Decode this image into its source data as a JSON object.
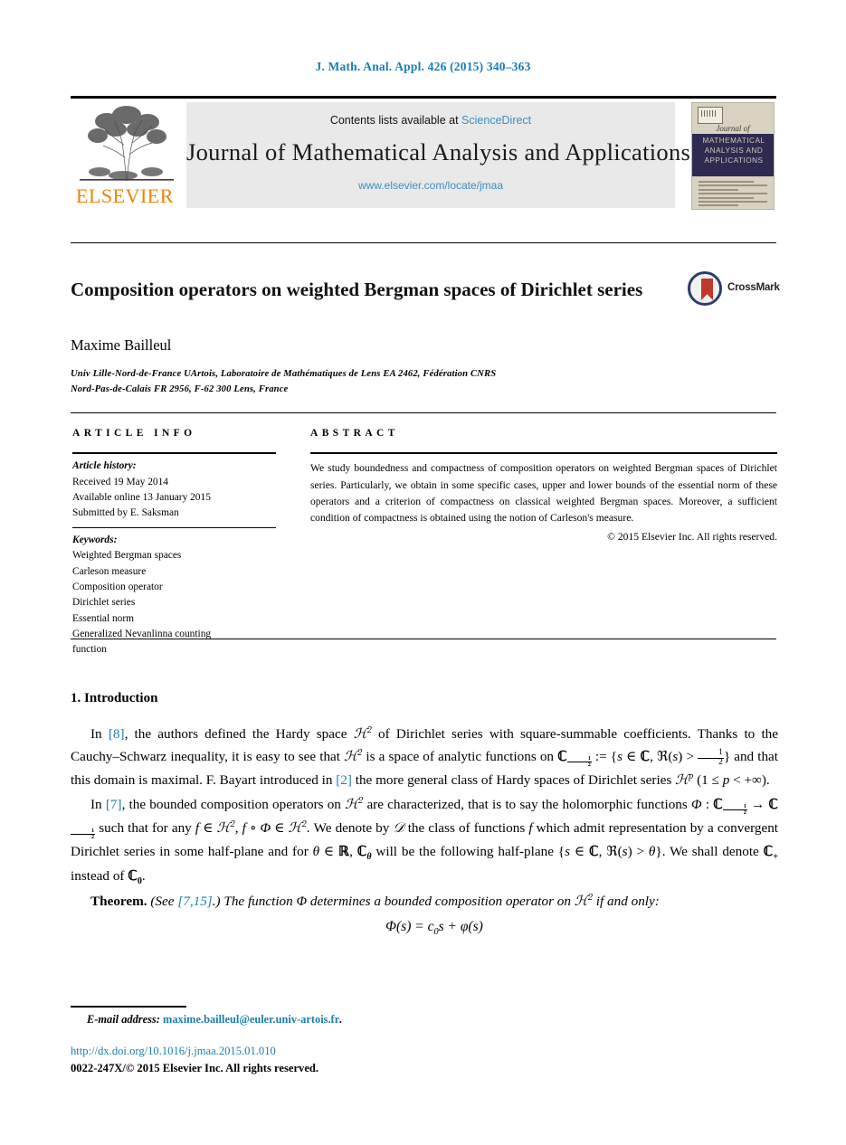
{
  "running_head": "J. Math. Anal. Appl. 426 (2015) 340–363",
  "masthead": {
    "contents_prefix": "Contents lists available at",
    "sciencedirect": "ScienceDirect",
    "journal_title": "Journal of Mathematical Analysis and Applications",
    "journal_url": "www.elsevier.com/locate/jmaa",
    "publisher": "ELSEVIER",
    "cover": {
      "journal_of": "Journal of",
      "band_title": "MATHEMATICAL ANALYSIS AND APPLICATIONS"
    }
  },
  "article": {
    "title": "Composition operators on weighted Bergman spaces of Dirichlet series",
    "crossmark_label": "CrossMark",
    "author": "Maxime Bailleul",
    "affiliation_line1": "Univ Lille-Nord-de-France UArtois, Laboratoire de Mathématiques de Lens EA 2462, Fédération CNRS",
    "affiliation_line2": "Nord-Pas-de-Calais FR 2956, F-62 300 Lens, France"
  },
  "info": {
    "label": "ARTICLE INFO",
    "history_header": "Article history:",
    "history": [
      "Received 19 May 2014",
      "Available online 13 January 2015",
      "Submitted by E. Saksman"
    ],
    "keywords_header": "Keywords:",
    "keywords": [
      "Weighted Bergman spaces",
      "Carleson measure",
      "Composition operator",
      "Dirichlet series",
      "Essential norm",
      "Generalized Nevanlinna counting",
      "function"
    ]
  },
  "abstract": {
    "label": "ABSTRACT",
    "text": "We study boundedness and compactness of composition operators on weighted Bergman spaces of Dirichlet series. Particularly, we obtain in some specific cases, upper and lower bounds of the essential norm of these operators and a criterion of compactness on classical weighted Bergman spaces. Moreover, a sufficient condition of compactness is obtained using the notion of Carleson's measure.",
    "copyright": "© 2015 Elsevier Inc. All rights reserved."
  },
  "body": {
    "section_heading": "1. Introduction",
    "p1_a": "In ",
    "p1_ref1": "[8]",
    "p1_b": ", the authors defined the Hardy space ",
    "p1_c": " of Dirichlet series with square-summable coefficients. Thanks to the Cauchy–Schwarz inequality, it is easy to see that ",
    "p1_d": " is a space of analytic functions on ",
    "p1_e": " and that this domain is maximal. F. Bayart introduced in ",
    "p1_ref2": "[2]",
    "p1_f": " the more general class of Hardy spaces of Dirichlet series ",
    "p2_a": "In ",
    "p2_ref": "[7]",
    "p2_b": ", the bounded composition operators on ",
    "p2_c": " are characterized, that is to say the holomorphic functions ",
    "p2_d": " such that for any ",
    "p2_e": ". We denote by ",
    "p2_f": " the class of functions ",
    "p2_g": " which admit representation by a convergent Dirichlet series in some half-plane and for ",
    "p2_h": " will be the following half-plane ",
    "p2_i": ". We shall denote ",
    "p2_j": " instead of ",
    "theorem_label": "Theorem.",
    "theorem_see": "(See ",
    "theorem_ref": "[7,15]",
    "theorem_see_end": ".)",
    "theorem_text_a": " The function Φ determines a bounded composition operator on ",
    "theorem_text_b": " if and only:",
    "equation": "Φ(s) = c0s + φ(s)"
  },
  "footer": {
    "email_label": "E-mail address:",
    "email": "maxime.bailleul@euler.univ-artois.fr",
    "email_period": ".",
    "doi": "http://dx.doi.org/10.1016/j.jmaa.2015.01.010",
    "issn": "0022-247X/© 2015 Elsevier Inc. All rights reserved."
  },
  "colors": {
    "link_blue": "#1a7db5",
    "elsevier_orange": "#ef8200",
    "cover_navy": "#2e2a52",
    "crossmark_red": "#c0392b"
  }
}
